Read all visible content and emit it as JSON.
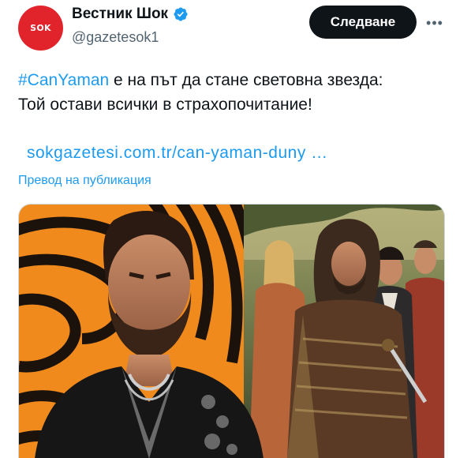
{
  "author": {
    "display_name": "Вестник Шок",
    "handle": "@gazetesok1",
    "avatar_text": "SOK",
    "verified": true
  },
  "actions": {
    "follow_label": "Следване",
    "more_label": "•••"
  },
  "post": {
    "hashtag": "#CanYaman",
    "text_after_hashtag": " е на път да стане световна звезда:",
    "line2": "Той остави всички в страхопочитание!",
    "link": "sokgazetesi.com.tr/can-yaman-duny …",
    "translate_label": "Превод на публикация"
  },
  "media": {
    "alt": "photo"
  },
  "colors": {
    "accent": "#1d9bf0",
    "follow_bg": "#0f1419",
    "avatar_bg": "#e1242b",
    "stripe_orange": "#f08a1c"
  }
}
